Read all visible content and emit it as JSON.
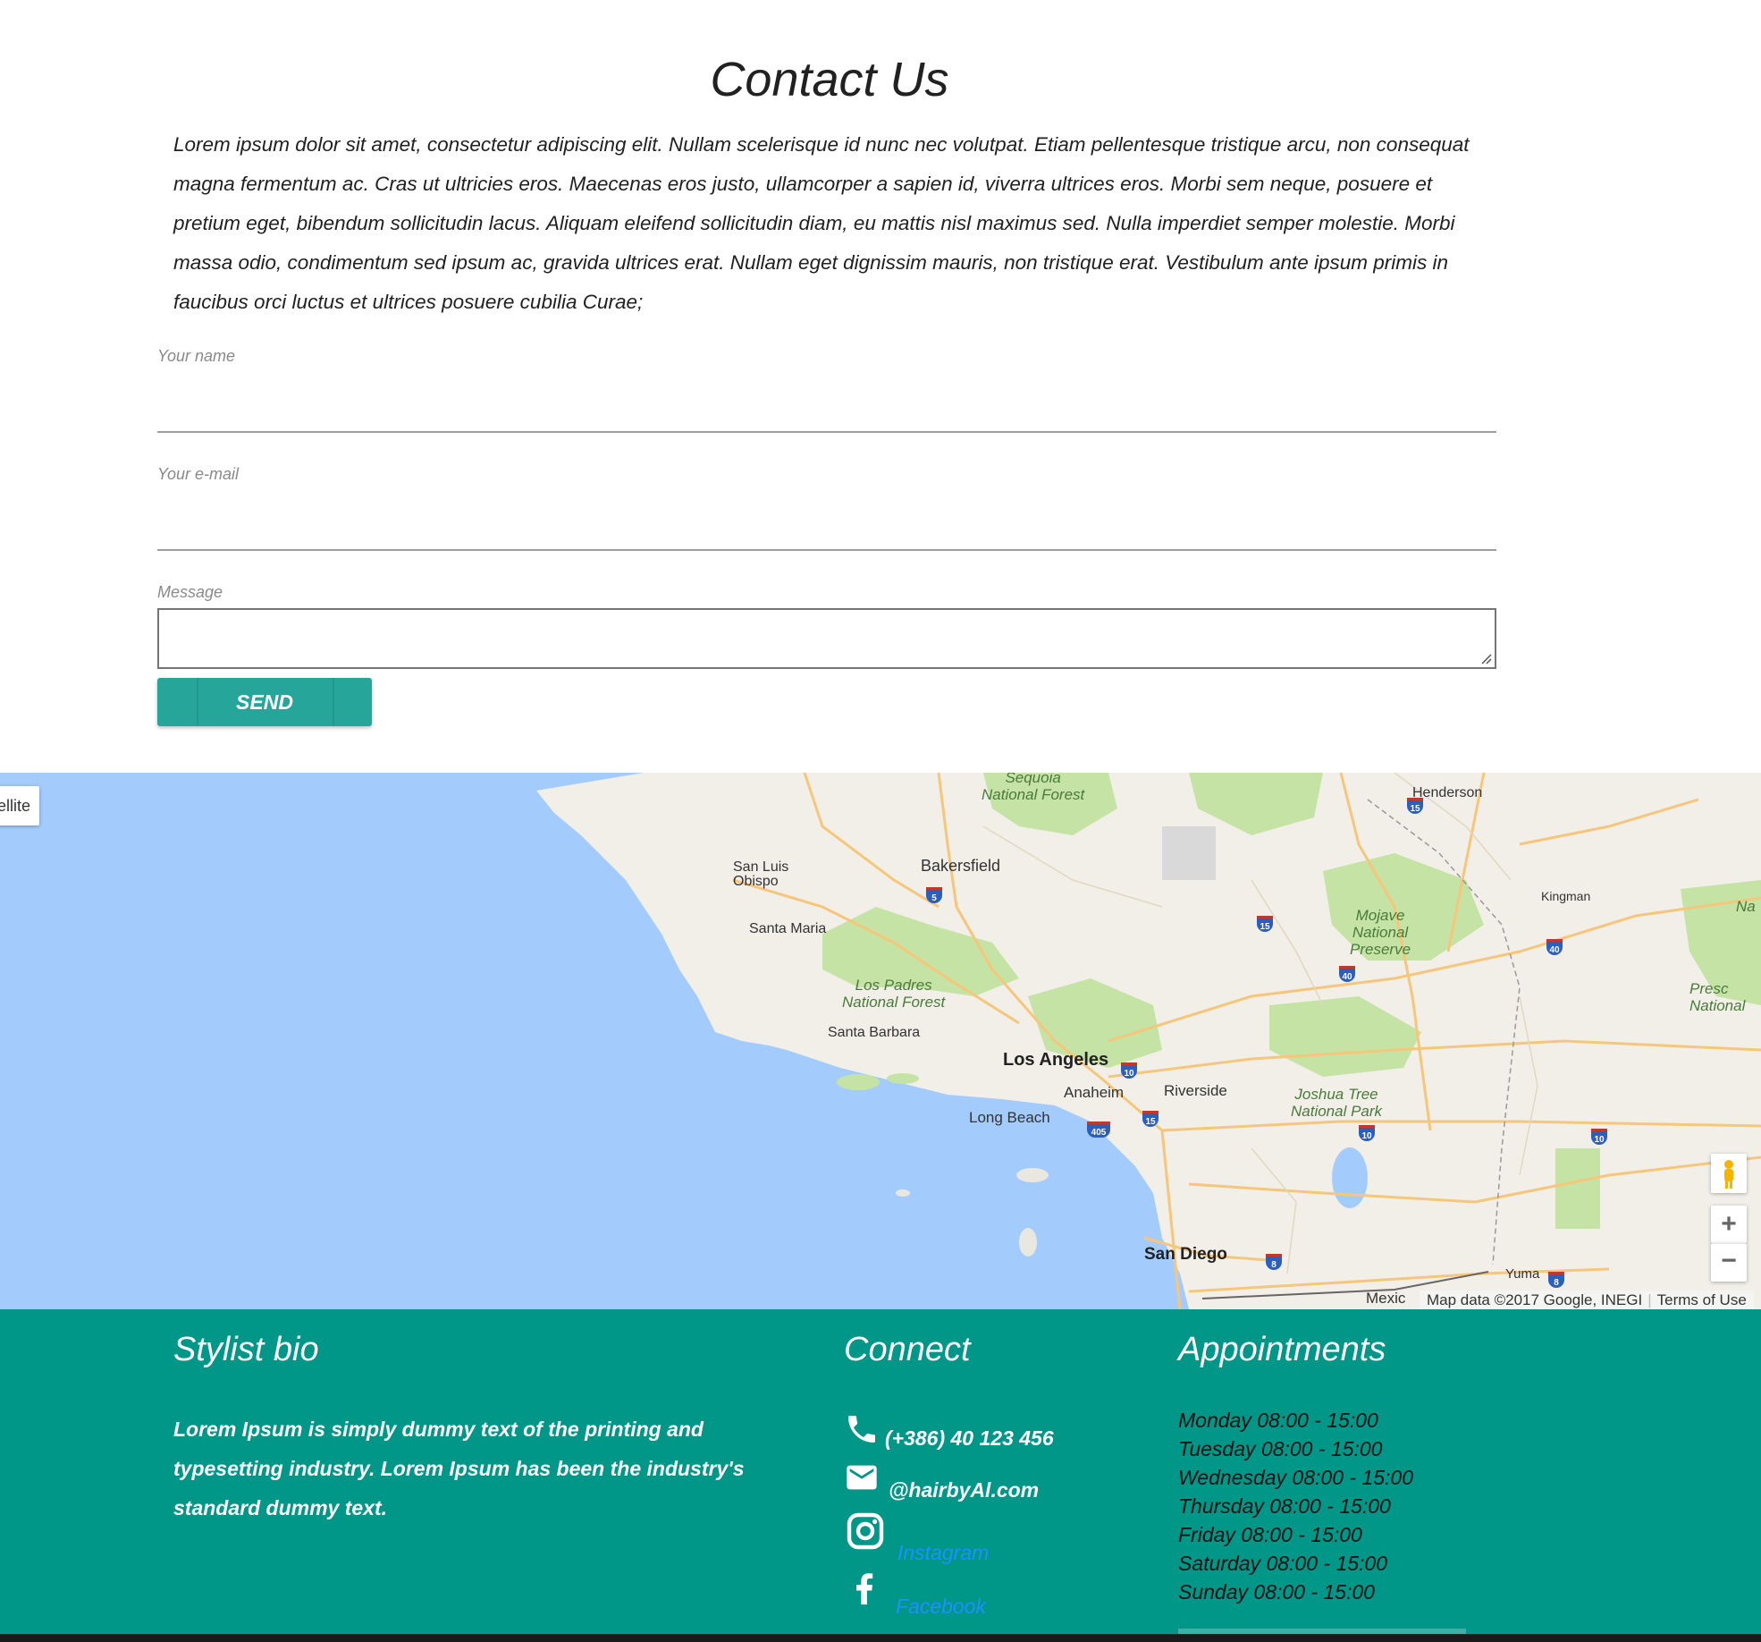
{
  "contact": {
    "title": "Contact Us",
    "intro": "Lorem ipsum dolor sit amet, consectetur adipiscing elit. Nullam scelerisque id nunc nec volutpat. Etiam pellentesque tristique arcu, non consequat magna fermentum ac. Cras ut ultricies eros. Maecenas eros justo, ullamcorper a sapien id, viverra ultrices eros. Morbi sem neque, posuere et pretium eget, bibendum sollicitudin lacus. Aliquam eleifend sollicitudin diam, eu mattis nisl maximus sed. Nulla imperdiet semper molestie. Morbi massa odio, condimentum sed ipsum ac, gravida ultrices erat. Nullam eget dignissim mauris, non tristique erat. Vestibulum ante ipsum primis in faucibus orci luctus et ultrices posuere cubilia Curae;",
    "name_label": "Your name",
    "name_value": "",
    "email_label": "Your e-mail",
    "email_value": "",
    "message_label": "Message",
    "message_value": "",
    "send_label": "SEND"
  },
  "map": {
    "map_type_label": "ellite",
    "attribution": "Map data ©2017 Google, INEGI",
    "terms": "Terms of Use",
    "zoom_in": "+",
    "zoom_out": "−",
    "labels": {
      "sequoia": "Sequoia\nNational Forest",
      "henderson": "Henderson",
      "san_luis_obispo": "San Luis\nObispo",
      "bakersfield": "Bakersfield",
      "kingman": "Kingman",
      "santa_maria": "Santa Maria",
      "mojave": "Mojave\nNational\nPreserve",
      "los_padres": "Los Padres\nNational Forest",
      "santa_barbara": "Santa Barbara",
      "los_angeles": "Los Angeles",
      "anaheim": "Anaheim",
      "riverside": "Riverside",
      "long_beach": "Long Beach",
      "joshua_tree": "Joshua Tree\nNational Park",
      "prescott": "Presc\nNational",
      "nat_edge": "Na",
      "san_diego": "San Diego",
      "yuma": "Yuma",
      "mexicali": "Mexic"
    },
    "shields": [
      "5",
      "15",
      "15",
      "40",
      "40",
      "10",
      "15",
      "405",
      "10",
      "10",
      "8",
      "8",
      "15"
    ],
    "colors": {
      "water": "#a3ccfd",
      "land": "#f2efe9",
      "park": "#c5e3a5",
      "road": "#f6c67a",
      "highway_shield": "#2c5fbd"
    }
  },
  "footer": {
    "bio_title": "Stylist bio",
    "bio_text": "Lorem Ipsum is simply dummy text of the printing and typesetting industry. Lorem Ipsum has been the industry's standard dummy text.",
    "connect_title": "Connect",
    "phone": "(+386) 40 123 456",
    "email": "@hairbyAl.com",
    "instagram": "Instagram",
    "facebook": "Facebook",
    "appointments_title": "Appointments",
    "appointments": [
      "Monday 08:00 - 15:00",
      "Tuesday 08:00 - 15:00",
      "Wednesday 08:00 - 15:00",
      "Thursday 08:00 - 15:00",
      "Friday 08:00 - 15:00",
      "Saturday 08:00 - 15:00",
      "Sunday 08:00 - 15:00"
    ],
    "colors": {
      "background": "#009688",
      "link": "#1e90ff"
    }
  }
}
